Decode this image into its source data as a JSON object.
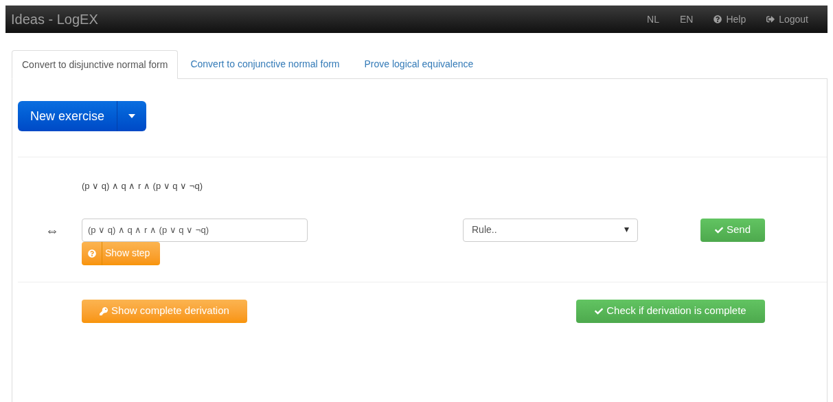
{
  "navbar": {
    "brand": "Ideas - LogEX",
    "links": [
      {
        "label": "NL",
        "kind": "text"
      },
      {
        "label": "EN",
        "kind": "text"
      },
      {
        "label": "Help",
        "kind": "help"
      },
      {
        "label": "Logout",
        "kind": "logout"
      }
    ]
  },
  "tabs": [
    {
      "label": "Convert to disjunctive normal form",
      "selected": true
    },
    {
      "label": "Convert to conjunctive normal form",
      "selected": false
    },
    {
      "label": "Prove logical equivalence",
      "selected": false
    }
  ],
  "new_exercise": {
    "label": "New exercise"
  },
  "derivation": {
    "start": "(p ∨ q) ∧ q ∧ r ∧ (p ∨ q ∨ ¬q)",
    "step": {
      "symbol": "⇔",
      "value": "(p ∨ q) ∧ q ∧ r ∧ (p ∨ q ∨ ¬q)",
      "rule": "Rule..",
      "send": "Send",
      "show_step": "Show step"
    }
  },
  "actions": {
    "show_complete": "Show complete derivation",
    "check": "Check if derivation is complete"
  }
}
